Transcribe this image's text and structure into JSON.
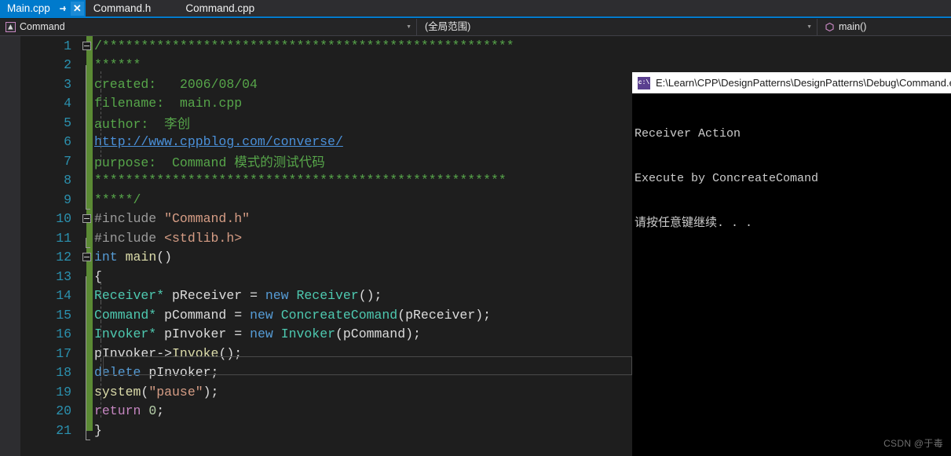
{
  "tabs": [
    {
      "label": "Main.cpp",
      "active": true,
      "pin_icon": "pin-icon",
      "close_icon": "close-icon"
    },
    {
      "label": "Command.h",
      "active": false
    },
    {
      "label": "Command.cpp",
      "active": false
    }
  ],
  "navbar": {
    "project": "Command",
    "project_icon": "project-icon",
    "scope": "(全局范围)",
    "member": "main()",
    "member_icon": "method-icon",
    "dropdown_icon": "chevron-down-icon"
  },
  "editor": {
    "lines": [
      {
        "n": "1",
        "text": "/*****************************************************"
      },
      {
        "n": "2",
        "text": "******"
      },
      {
        "n": "3",
        "text": "    created:  2006/08/04"
      },
      {
        "n": "4",
        "text": "    filename: main.cpp"
      },
      {
        "n": "5",
        "text": "    author:   李创"
      },
      {
        "n": "6",
        "text": "    http://www.cppblog.com/converse/"
      },
      {
        "n": "7",
        "text": "    purpose:  Command 模式的测试代码"
      },
      {
        "n": "8",
        "text": "*****************************************************"
      },
      {
        "n": "9",
        "text": "*****/"
      },
      {
        "n": "10",
        "text": "#include \"Command.h\""
      },
      {
        "n": "11",
        "text": "#include <stdlib.h>"
      },
      {
        "n": "12",
        "text": "int main()"
      },
      {
        "n": "13",
        "text": "{"
      },
      {
        "n": "14",
        "text": "    Receiver* pReceiver = new Receiver();"
      },
      {
        "n": "15",
        "text": "    Command* pCommand = new ConcreateComand(pReceiver);"
      },
      {
        "n": "16",
        "text": "    Invoker* pInvoker = new Invoker(pCommand);"
      },
      {
        "n": "17",
        "text": "    pInvoker->Invoke();"
      },
      {
        "n": "18",
        "text": "    delete pInvoker;"
      },
      {
        "n": "19",
        "text": "    system(\"pause\");"
      },
      {
        "n": "20",
        "text": "    return 0;"
      },
      {
        "n": "21",
        "text": "}"
      }
    ],
    "tokens": {
      "stars_top": "/*****************************************************",
      "stars_top2": "******",
      "created_label": "created:",
      "created_value": "2006/08/04",
      "filename_label": "filename:",
      "filename_value": "main.cpp",
      "author_label": "author:",
      "author_value": "李创",
      "url": "http://www.cppblog.com/converse/",
      "purpose_label": "purpose:",
      "purpose_value": "Command 模式的测试代码",
      "stars_bot": "*****************************************************",
      "stars_bot2": "*****/",
      "inc1_kw": "#include",
      "inc1_arg": "\"Command.h\"",
      "inc2_kw": "#include",
      "inc2_arg": "<stdlib.h>",
      "int_kw": "int",
      "main_fn": "main",
      "main_parens": "()",
      "open_brace": "{",
      "close_brace": "}",
      "receiver_type": "Receiver*",
      "receiver_var": "pReceiver",
      "eq": "=",
      "new_kw": "new",
      "receiver_ctor": "Receiver",
      "receiver_call": "();",
      "command_type": "Command*",
      "command_var": "pCommand",
      "concrete_ctor": "ConcreateComand",
      "concrete_args": "(pReceiver);",
      "invoker_type": "Invoker*",
      "invoker_var": "pInvoker",
      "invoker_ctor": "Invoker",
      "invoker_args": "(pCommand);",
      "invoke_obj": "pInvoker->",
      "invoke_fn": "Invoke",
      "invoke_call": "();",
      "delete_kw": "delete",
      "delete_var": "pInvoker;",
      "system_fn": "system",
      "system_open": "(",
      "system_str": "\"pause\"",
      "system_close": ");",
      "return_kw": "return",
      "return_val": "0",
      "return_semi": ";"
    },
    "current_line": "16"
  },
  "console": {
    "title": "E:\\Learn\\CPP\\DesignPatterns\\DesignPatterns\\Debug\\Command.e",
    "icon": "console-app-icon",
    "icon_glyph": "c:\\",
    "output": [
      "Receiver Action",
      "Execute by ConcreateComand",
      "请按任意键继续. . ."
    ]
  },
  "watermark": "CSDN @于毒",
  "colors": {
    "accent": "#007acc",
    "editor_bg": "#1e1e1e",
    "gutter_bg": "#2d2d30",
    "changebar": "#5b8a34",
    "comment": "#57a64a",
    "keyword": "#569cd6",
    "type": "#4ec9b0",
    "string": "#d69d85",
    "linenumber": "#2b91af"
  }
}
